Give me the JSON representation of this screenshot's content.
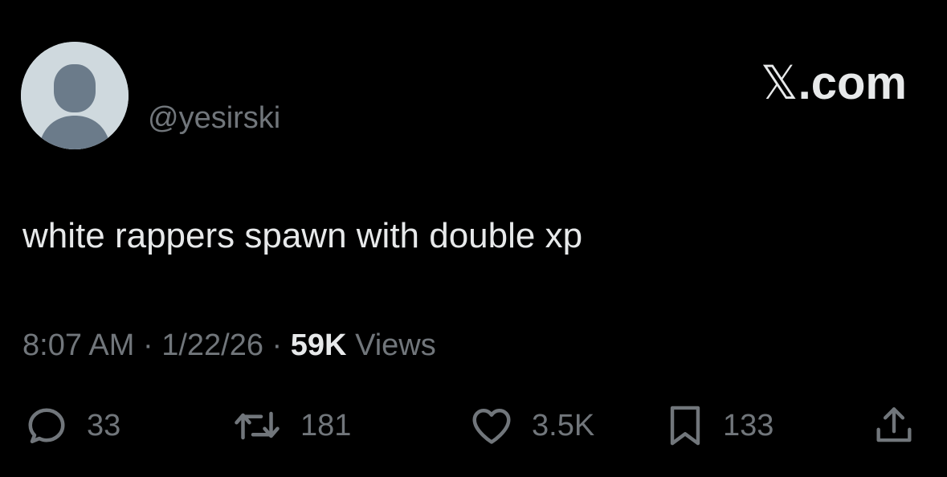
{
  "author": {
    "handle": "@yesirski",
    "avatar": "default-avatar-icon"
  },
  "brand": {
    "label": ".com",
    "logo": "x-logo-icon"
  },
  "tweet": {
    "text": "white rappers spawn with double xp"
  },
  "meta": {
    "time": "8:07 AM",
    "separator": " · ",
    "date": "1/22/26",
    "views_count": "59K",
    "views_label": "Views"
  },
  "actions": {
    "replies": "33",
    "reposts": "181",
    "likes": "3.5K",
    "bookmarks": "133",
    "icons": [
      "reply-icon",
      "repost-icon",
      "like-icon",
      "bookmark-icon",
      "share-icon"
    ]
  },
  "colors": {
    "background": "#000000",
    "primary_text": "#e7e9ea",
    "secondary_text": "#71767b",
    "avatar_bg": "#cfd9de",
    "avatar_figure": "#6b7b8a"
  }
}
